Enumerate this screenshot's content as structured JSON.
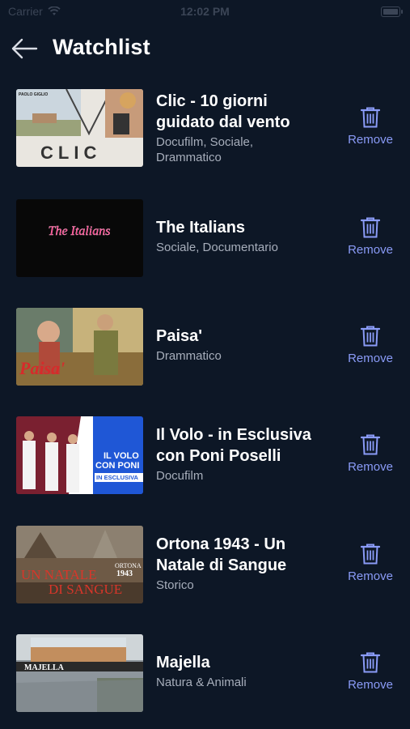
{
  "status_bar": {
    "carrier": "Carrier",
    "time": "12:02 PM"
  },
  "header": {
    "title": "Watchlist",
    "back_icon": "arrow-left-icon"
  },
  "items": [
    {
      "title": "Clic - 10 giorni guidato dal vento",
      "genre": "Docufilm, Sociale, Drammatico",
      "remove_label": "Remove",
      "poster_text": "CLIC"
    },
    {
      "title": "The Italians",
      "genre": "Sociale, Documentario",
      "remove_label": "Remove",
      "poster_text": "The Italians"
    },
    {
      "title": "Paisa'",
      "genre": "Drammatico",
      "remove_label": "Remove",
      "poster_text": "Paisa'"
    },
    {
      "title": "Il Volo - in Esclusiva con Poni Poselli",
      "genre": "Docufilm",
      "remove_label": "Remove",
      "poster_text": "IL VOLO CON PONI",
      "poster_badge": "IN ESCLUSIVA"
    },
    {
      "title": "Ortona 1943 - Un Natale di Sangue",
      "genre": "Storico",
      "remove_label": "Remove",
      "poster_text": "UN NATALE DI SANGUE"
    },
    {
      "title": "Majella",
      "genre": "Natura & Animali",
      "remove_label": "Remove",
      "poster_text": "MAJELLA"
    }
  ],
  "colors": {
    "background": "#0d1726",
    "accent": "#8a9bf7",
    "secondary_text": "#a7aebb"
  }
}
